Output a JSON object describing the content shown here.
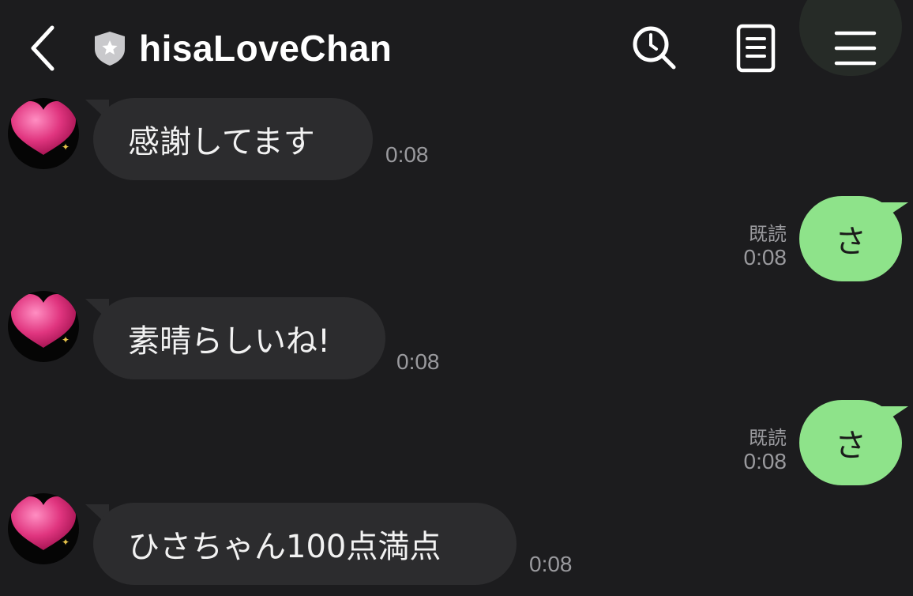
{
  "header": {
    "title": "hisaLoveChan",
    "icons": {
      "back": "chevron-left-icon",
      "badge": "shield-star-icon",
      "search": "clock-search-icon",
      "notes": "notes-icon",
      "menu": "hamburger-menu-icon"
    }
  },
  "colors": {
    "background": "#1c1c1e",
    "incoming_bubble": "#2c2c2e",
    "outgoing_bubble": "#8ee38a",
    "meta_text": "#9a9a9e"
  },
  "messages": [
    {
      "direction": "in",
      "text": "感謝してます",
      "time": "0:08"
    },
    {
      "direction": "out",
      "text": "さ",
      "read": "既読",
      "time": "0:08"
    },
    {
      "direction": "in",
      "text": "素晴らしいね!",
      "time": "0:08"
    },
    {
      "direction": "out",
      "text": "さ",
      "read": "既読",
      "time": "0:08"
    },
    {
      "direction": "in",
      "text": "ひさちゃん100点満点",
      "time": "0:08"
    }
  ]
}
